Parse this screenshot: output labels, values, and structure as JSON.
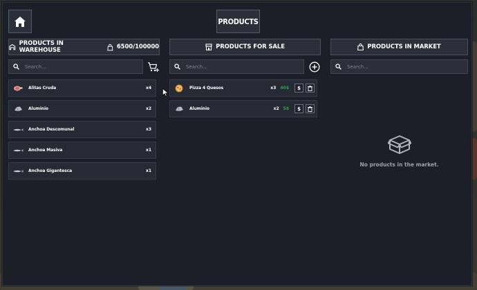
{
  "header": {
    "title": "PRODUCTS"
  },
  "warehouse": {
    "title": "PRODUCTS IN WAREHOUSE",
    "capacity": "6500/100000",
    "search_placeholder": "Search...",
    "items": [
      {
        "name": "Alitas Cruda",
        "qty": "x4",
        "icon": "meat-icon"
      },
      {
        "name": "Aluminio",
        "qty": "x2",
        "icon": "aluminium-icon"
      },
      {
        "name": "Anchoa Descomunal",
        "qty": "x3",
        "icon": "fish-icon"
      },
      {
        "name": "Anchoa Masiva",
        "qty": "x1",
        "icon": "fish-icon"
      },
      {
        "name": "Anchoa Gigantesca",
        "qty": "x1",
        "icon": "fish-icon"
      }
    ]
  },
  "sale": {
    "title": "PRODUCTS FOR SALE",
    "search_placeholder": "Search...",
    "items": [
      {
        "name": "Pizza 4 Quesos",
        "qty": "x3",
        "price": "40$",
        "icon": "pizza-icon"
      },
      {
        "name": "Aluminio",
        "qty": "x2",
        "price": "5$",
        "icon": "aluminium-icon"
      }
    ]
  },
  "market": {
    "title": "PRODUCTS IN MARKET",
    "search_placeholder": "Search...",
    "empty_text": "No products in the market."
  },
  "colors": {
    "panel": "#1c1f27",
    "card": "#262a34",
    "price": "#2fa04a",
    "border": "#555b69"
  }
}
